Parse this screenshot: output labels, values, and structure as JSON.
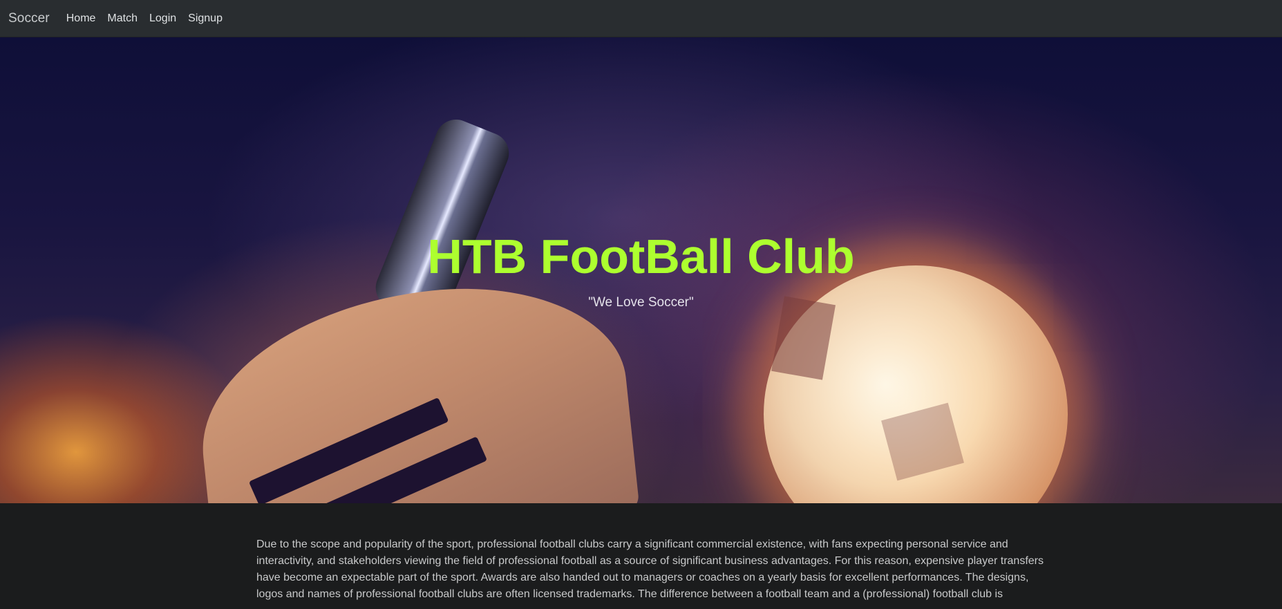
{
  "navbar": {
    "brand": "Soccer",
    "links": [
      "Home",
      "Match",
      "Login",
      "Signup"
    ]
  },
  "hero": {
    "title": "HTB FootBall Club",
    "subtitle": "\"We Love Soccer\""
  },
  "content": {
    "paragraph": "Due to the scope and popularity of the sport, professional football clubs carry a significant commercial existence, with fans expecting personal service and interactivity, and stakeholders viewing the field of professional football as a source of significant business advantages. For this reason, expensive player transfers have become an expectable part of the sport. Awards are also handed out to managers or coaches on a yearly basis for excellent performances. The designs, logos and names of professional football clubs are often licensed trademarks. The difference between a football team and a (professional) football club is"
  },
  "colors": {
    "navbar_bg": "#292d30",
    "page_bg": "#1b1c1d",
    "title_color": "#adff2f"
  }
}
